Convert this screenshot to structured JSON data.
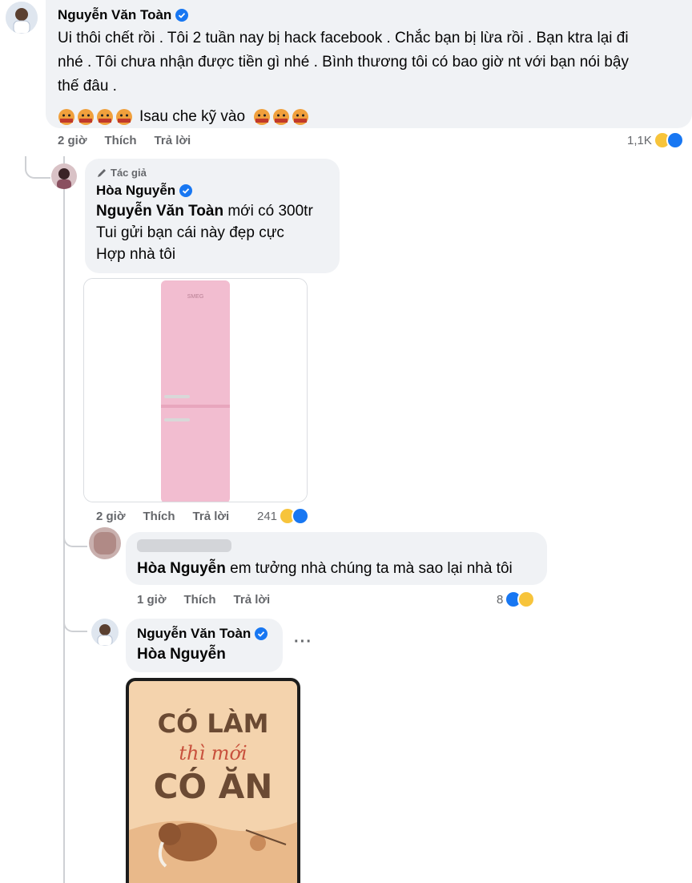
{
  "comment1": {
    "author": "Nguyễn Văn Toàn",
    "line1": "Ui thôi chết rồi . Tôi 2 tuần nay bị hack facebook . Chắc bạn bị lừa rồi . Bạn ktra lại đi",
    "line2": "nhé . Tôi chưa nhận được tiền gì nhé . Bình thương tôi có bao giờ nt với bạn nói bậy",
    "line3": "thế đâu .",
    "line4_text": "Isau che kỹ vào",
    "time": "2 giờ",
    "like": "Thích",
    "reply": "Trả lời",
    "reaction_count": "1,1K"
  },
  "comment2": {
    "badge": "Tác giả",
    "author": "Hòa Nguyễn",
    "mention": "Nguyễn Văn Toàn",
    "line1_rest": " mới có 300tr",
    "line2": "Tui gửi bạn cái này đẹp cực",
    "line3": "Hợp nhà tôi",
    "fridge_brand": "SMEG",
    "time": "2 giờ",
    "like": "Thích",
    "reply": "Trả lời",
    "reaction_count": "241"
  },
  "comment3": {
    "mention": "Hòa Nguyễn",
    "text_rest": " em tưởng nhà chúng ta mà sao lại nhà tôi",
    "time": "1 giờ",
    "like": "Thích",
    "reply": "Trả lời",
    "reaction_count": "8"
  },
  "comment4": {
    "author": "Nguyễn Văn Toàn",
    "mention": "Hòa Nguyễn",
    "more": "···",
    "poster_line1": "CÓ LÀM",
    "poster_line2": "thì mới",
    "poster_line3": "CÓ ĂN"
  },
  "colors": {
    "bubble": "#f0f2f5",
    "meta": "#65676b",
    "verified": "#1877f2",
    "fridge": "#f2bdd0",
    "poster_bg": "#f4d3ad",
    "poster_text": "#6b4a33"
  }
}
